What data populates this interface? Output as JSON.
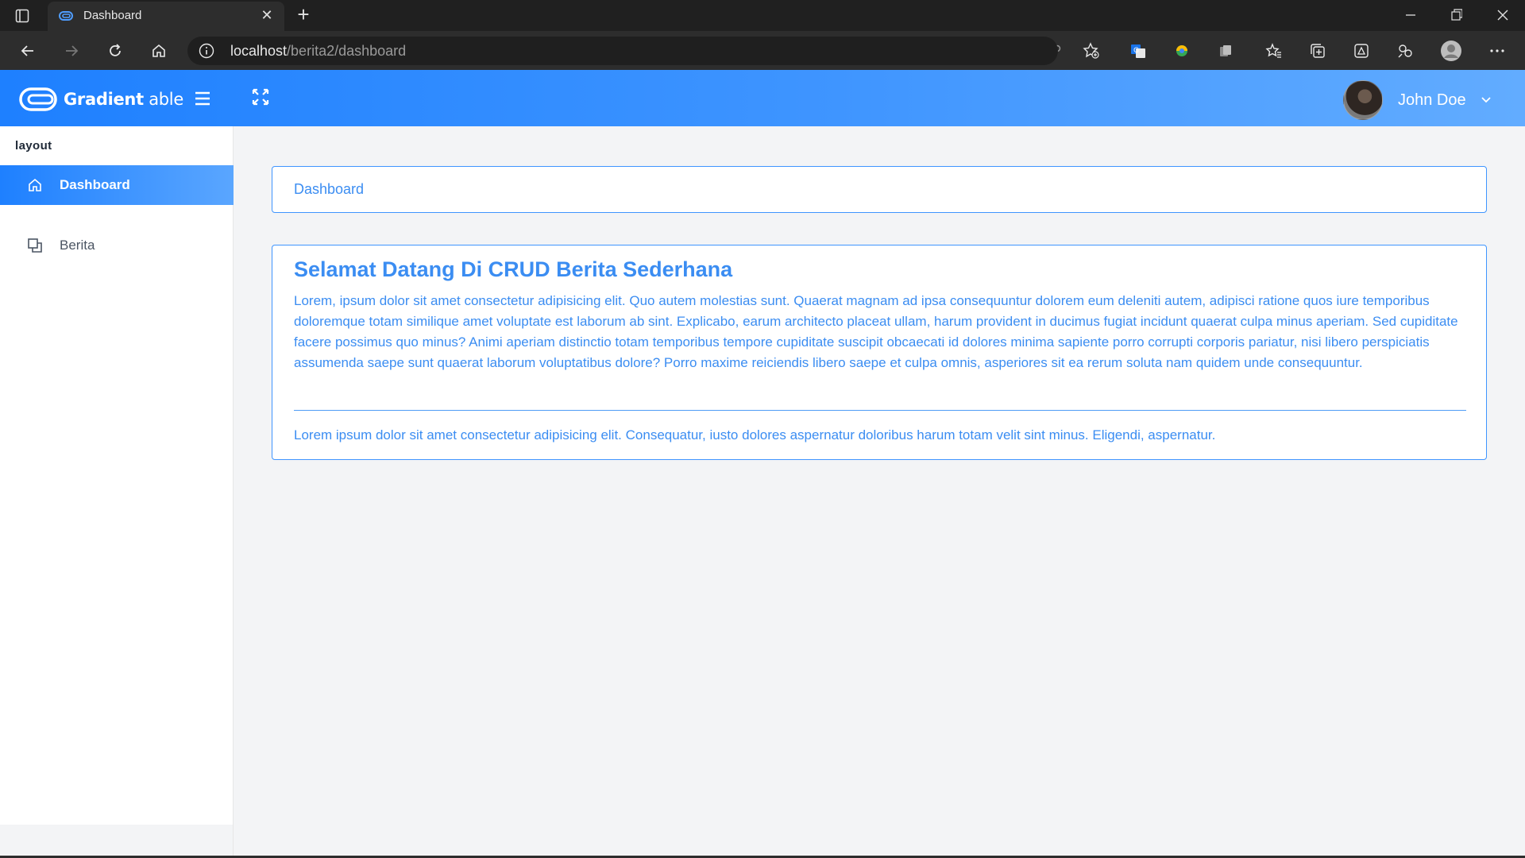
{
  "browser": {
    "tab_title": "Dashboard",
    "url_host": "localhost",
    "url_path": "/berita2/dashboard"
  },
  "app": {
    "brand_bold": "Gradient",
    "brand_light": " able",
    "user_name": "John Doe"
  },
  "sidebar": {
    "caption": "layout",
    "items": [
      {
        "label": "Dashboard",
        "icon": "home-icon",
        "active": true
      },
      {
        "label": "Berita",
        "icon": "copy-icon",
        "active": false
      }
    ]
  },
  "main": {
    "breadcrumb": "Dashboard",
    "title": "Selamat Datang Di CRUD Berita Sederhana",
    "paragraph1": "Lorem, ipsum dolor sit amet consectetur adipisicing elit. Quo autem molestias sunt. Quaerat magnam ad ipsa consequuntur dolorem eum deleniti autem, adipisci ratione quos iure temporibus doloremque totam similique amet voluptate est laborum ab sint. Explicabo, earum architecto placeat ullam, harum provident in ducimus fugiat incidunt quaerat culpa minus aperiam. Sed cupiditate facere possimus quo minus? Animi aperiam distinctio totam temporibus tempore cupiditate suscipit obcaecati id dolores minima sapiente porro corrupti corporis pariatur, nisi libero perspiciatis assumenda saepe sunt quaerat laborum voluptatibus dolore? Porro maxime reiciendis libero saepe et culpa omnis, asperiores sit ea rerum soluta nam quidem unde consequuntur.",
    "paragraph2": "Lorem ipsum dolor sit amet consectetur adipisicing elit. Consequatur, iusto dolores aspernatur doloribus harum totam velit sint minus. Eligendi, aspernatur."
  },
  "colors": {
    "accent": "#1e80ff",
    "text_blue": "#3b8df2"
  }
}
